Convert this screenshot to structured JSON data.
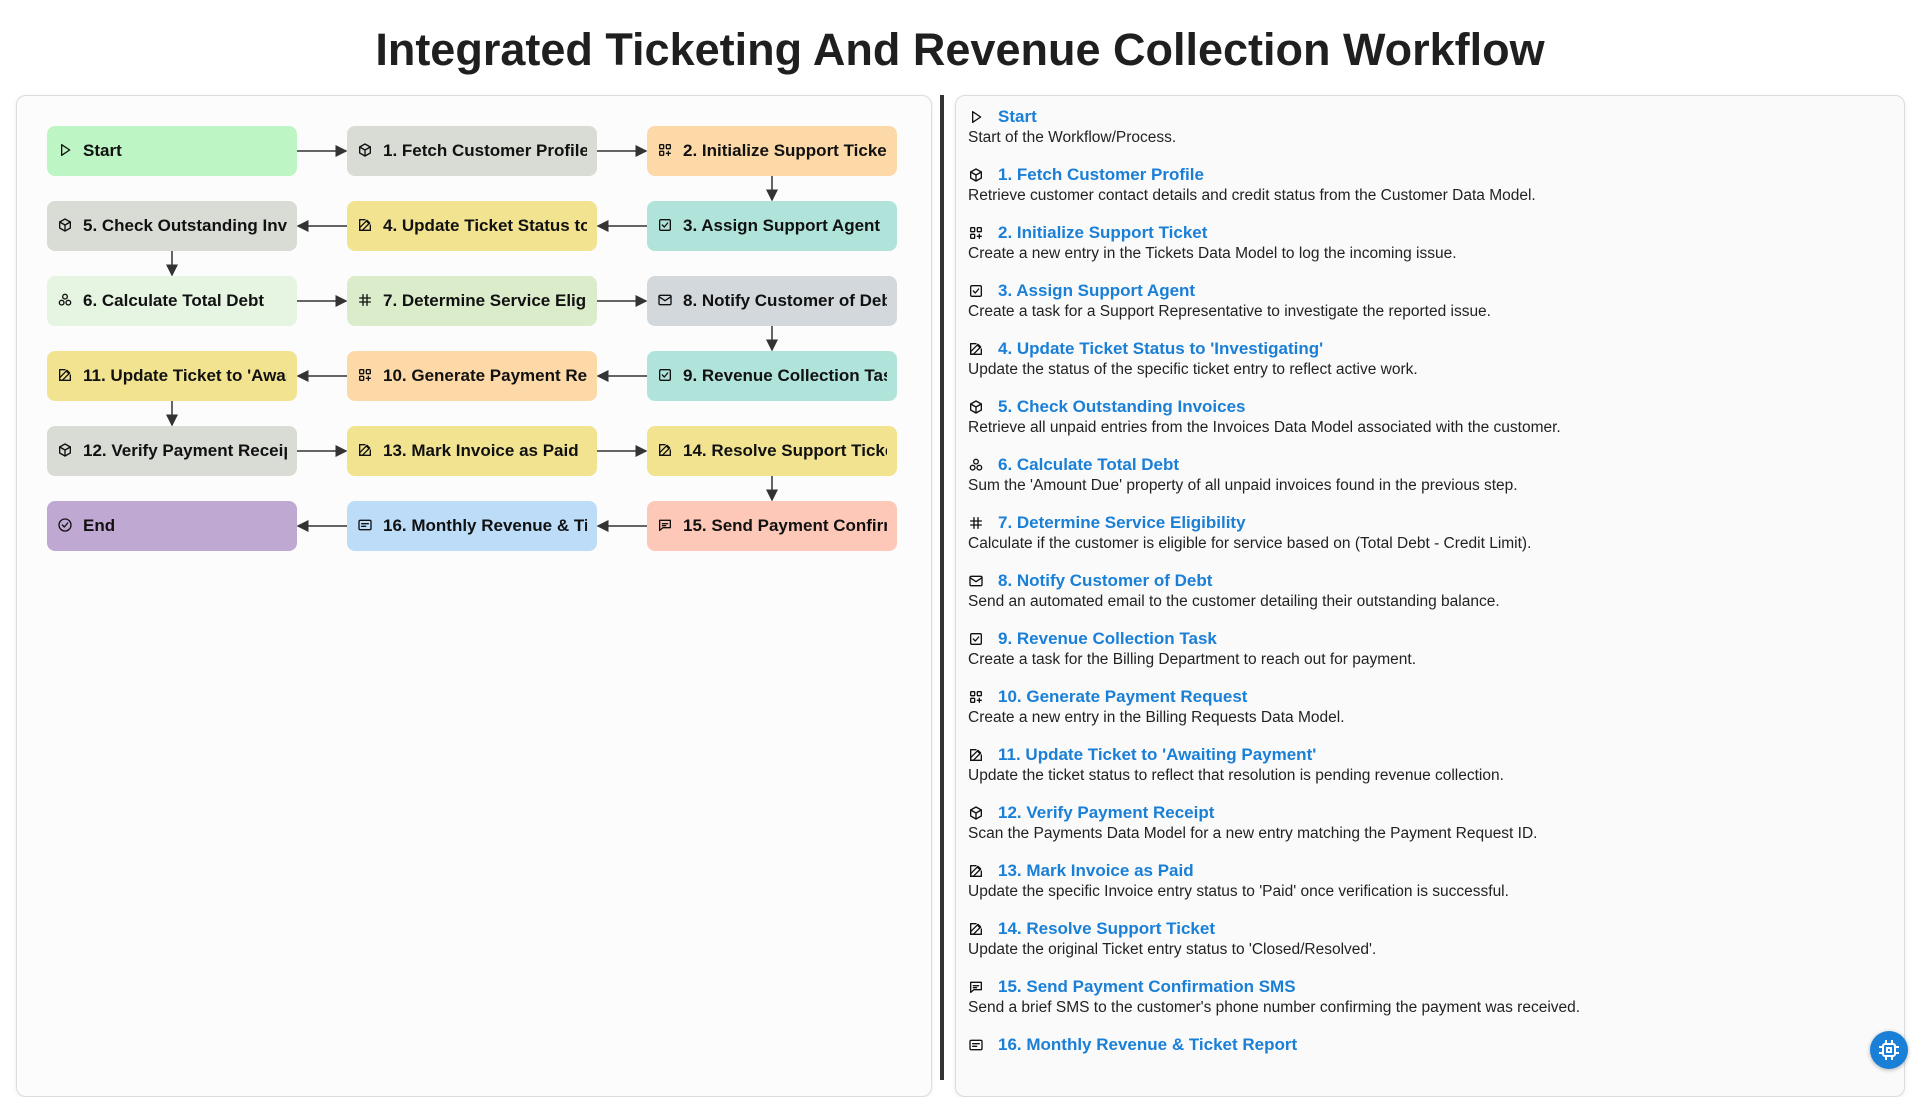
{
  "title": "Integrated Ticketing And Revenue Collection Workflow",
  "nodes": [
    {
      "id": "start",
      "label": "Start",
      "icon": "play-icon",
      "color": "#bdf5c4",
      "col": 0,
      "row": 0
    },
    {
      "id": "n1",
      "label": "1. Fetch Customer Profile",
      "icon": "cube-icon",
      "color": "#d8dcd5",
      "col": 1,
      "row": 0
    },
    {
      "id": "n2",
      "label": "2. Initialize Support Ticket",
      "icon": "apps-add-icon",
      "color": "#fdd9a8",
      "col": 2,
      "row": 0
    },
    {
      "id": "n3",
      "label": "3. Assign Support Agent",
      "icon": "checkbox-icon",
      "color": "#b0e3da",
      "col": 2,
      "row": 1
    },
    {
      "id": "n4",
      "label": "4. Update Ticket Status to 'Investigating'",
      "icon": "edit-icon",
      "color": "#f2e390",
      "col": 1,
      "row": 1
    },
    {
      "id": "n5",
      "label": "5. Check Outstanding Invoices",
      "icon": "cube-icon",
      "color": "#d8dcd5",
      "col": 0,
      "row": 1
    },
    {
      "id": "n6",
      "label": "6. Calculate Total Debt",
      "icon": "cluster-icon",
      "color": "#e5f5e2",
      "col": 0,
      "row": 2
    },
    {
      "id": "n7",
      "label": "7. Determine Service Eligibility",
      "icon": "hash-icon",
      "color": "#dbeccb",
      "col": 1,
      "row": 2
    },
    {
      "id": "n8",
      "label": "8. Notify Customer of Debt",
      "icon": "mail-icon",
      "color": "#d2d8dc",
      "col": 2,
      "row": 2
    },
    {
      "id": "n9",
      "label": "9. Revenue Collection Task",
      "icon": "checkbox-icon",
      "color": "#b0e3da",
      "col": 2,
      "row": 3
    },
    {
      "id": "n10",
      "label": "10. Generate Payment Request",
      "icon": "apps-add-icon",
      "color": "#fdd9a8",
      "col": 1,
      "row": 3
    },
    {
      "id": "n11",
      "label": "11. Update Ticket to 'Awaiting Payment'",
      "icon": "edit-icon",
      "color": "#f2e390",
      "col": 0,
      "row": 3
    },
    {
      "id": "n12",
      "label": "12. Verify Payment Receipt",
      "icon": "cube-icon",
      "color": "#d8dcd5",
      "col": 0,
      "row": 4
    },
    {
      "id": "n13",
      "label": "13. Mark Invoice as Paid",
      "icon": "edit-icon",
      "color": "#f2e390",
      "col": 1,
      "row": 4
    },
    {
      "id": "n14",
      "label": "14. Resolve Support Ticket",
      "icon": "edit-icon",
      "color": "#f2e390",
      "col": 2,
      "row": 4
    },
    {
      "id": "n15",
      "label": "15. Send Payment Confirmation SMS",
      "icon": "message-icon",
      "color": "#fec8b8",
      "col": 2,
      "row": 5
    },
    {
      "id": "n16",
      "label": "16. Monthly Revenue & Ticket Report",
      "icon": "report-icon",
      "color": "#bcdcf8",
      "col": 1,
      "row": 5
    },
    {
      "id": "end",
      "label": "End",
      "icon": "check-circle-icon",
      "color": "#bfa8d2",
      "col": 0,
      "row": 5
    }
  ],
  "edges": [
    [
      "start",
      "n1"
    ],
    [
      "n1",
      "n2"
    ],
    [
      "n2",
      "n3"
    ],
    [
      "n3",
      "n4"
    ],
    [
      "n4",
      "n5"
    ],
    [
      "n5",
      "n6"
    ],
    [
      "n6",
      "n7"
    ],
    [
      "n7",
      "n8"
    ],
    [
      "n8",
      "n9"
    ],
    [
      "n9",
      "n10"
    ],
    [
      "n10",
      "n11"
    ],
    [
      "n11",
      "n12"
    ],
    [
      "n12",
      "n13"
    ],
    [
      "n13",
      "n14"
    ],
    [
      "n14",
      "n15"
    ],
    [
      "n15",
      "n16"
    ],
    [
      "n16",
      "end"
    ]
  ],
  "details": [
    {
      "title": "Start",
      "icon": "play-icon",
      "desc": "Start of the Workflow/Process."
    },
    {
      "title": "1. Fetch Customer Profile",
      "icon": "cube-icon",
      "desc": "Retrieve customer contact details and credit status from the Customer Data Model."
    },
    {
      "title": "2. Initialize Support Ticket",
      "icon": "apps-add-icon",
      "desc": "Create a new entry in the Tickets Data Model to log the incoming issue."
    },
    {
      "title": "3. Assign Support Agent",
      "icon": "checkbox-icon",
      "desc": "Create a task for a Support Representative to investigate the reported issue."
    },
    {
      "title": "4. Update Ticket Status to 'Investigating'",
      "icon": "edit-icon",
      "desc": "Update the status of the specific ticket entry to reflect active work."
    },
    {
      "title": "5. Check Outstanding Invoices",
      "icon": "cube-icon",
      "desc": "Retrieve all unpaid entries from the Invoices Data Model associated with the customer."
    },
    {
      "title": "6. Calculate Total Debt",
      "icon": "cluster-icon",
      "desc": "Sum the 'Amount Due' property of all unpaid invoices found in the previous step."
    },
    {
      "title": "7. Determine Service Eligibility",
      "icon": "hash-icon",
      "desc": "Calculate if the customer is eligible for service based on (Total Debt - Credit Limit)."
    },
    {
      "title": "8. Notify Customer of Debt",
      "icon": "mail-icon",
      "desc": "Send an automated email to the customer detailing their outstanding balance."
    },
    {
      "title": "9. Revenue Collection Task",
      "icon": "checkbox-icon",
      "desc": "Create a task for the Billing Department to reach out for payment."
    },
    {
      "title": "10. Generate Payment Request",
      "icon": "apps-add-icon",
      "desc": "Create a new entry in the Billing Requests Data Model."
    },
    {
      "title": "11. Update Ticket to 'Awaiting Payment'",
      "icon": "edit-icon",
      "desc": "Update the ticket status to reflect that resolution is pending revenue collection."
    },
    {
      "title": "12. Verify Payment Receipt",
      "icon": "cube-icon",
      "desc": "Scan the Payments Data Model for a new entry matching the Payment Request ID."
    },
    {
      "title": "13. Mark Invoice as Paid",
      "icon": "edit-icon",
      "desc": "Update the specific Invoice entry status to 'Paid' once verification is successful."
    },
    {
      "title": "14. Resolve Support Ticket",
      "icon": "edit-icon",
      "desc": "Update the original Ticket entry status to 'Closed/Resolved'."
    },
    {
      "title": "15. Send Payment Confirmation SMS",
      "icon": "message-icon",
      "desc": "Send a brief SMS to the customer's phone number confirming the payment was received."
    },
    {
      "title": "16. Monthly Revenue & Ticket Report",
      "icon": "report-icon",
      "desc": ""
    }
  ]
}
